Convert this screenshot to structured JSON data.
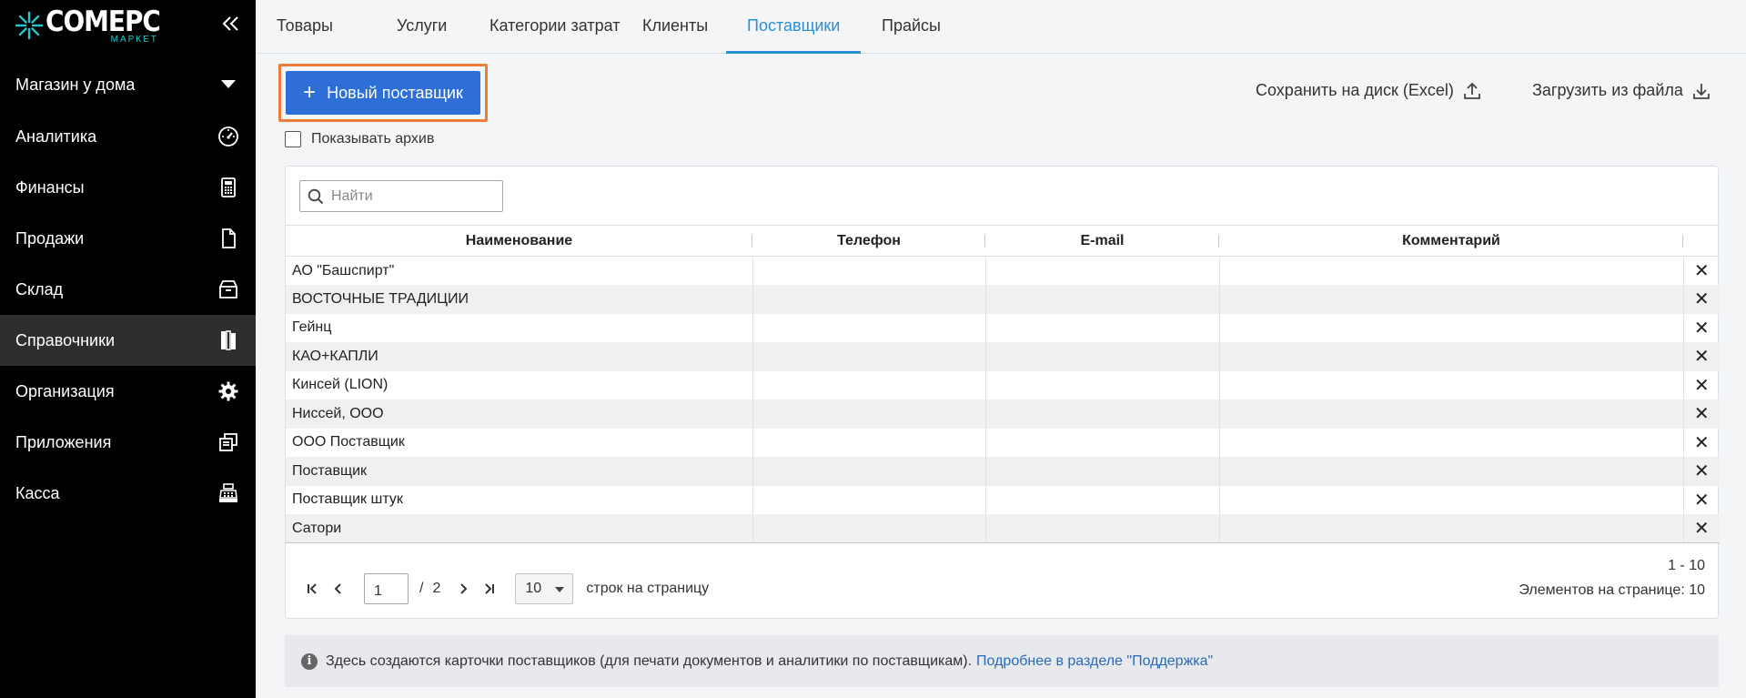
{
  "brand": {
    "name": "COMEPC",
    "sub": "МАРКЕТ"
  },
  "shop": {
    "name": "Магазин у дома"
  },
  "sidebar": {
    "items": [
      {
        "label": "Аналитика",
        "icon": "gauge-icon"
      },
      {
        "label": "Финансы",
        "icon": "calculator-icon"
      },
      {
        "label": "Продажи",
        "icon": "document-icon"
      },
      {
        "label": "Склад",
        "icon": "box-icon"
      },
      {
        "label": "Справочники",
        "icon": "books-icon",
        "active": true
      },
      {
        "label": "Организация",
        "icon": "gear-icon"
      },
      {
        "label": "Приложения",
        "icon": "windows-icon"
      },
      {
        "label": "Касса",
        "icon": "cash-register-icon"
      }
    ]
  },
  "tabs": [
    {
      "label": "Товары"
    },
    {
      "label": "Услуги"
    },
    {
      "label": "Категории затрат"
    },
    {
      "label": "Клиенты"
    },
    {
      "label": "Поставщики",
      "active": true
    },
    {
      "label": "Прайсы"
    }
  ],
  "toolbar": {
    "new_label": "Новый поставщик",
    "save_label": "Сохранить на диск (Excel)",
    "load_label": "Загрузить из файла",
    "archive_label": "Показывать архив"
  },
  "search": {
    "placeholder": "Найти",
    "value": ""
  },
  "table": {
    "columns": [
      "Наименование",
      "Телефон",
      "E-mail",
      "Комментарий"
    ],
    "rows": [
      {
        "name": "АО \"Башспирт\"",
        "phone": "",
        "email": "",
        "comment": ""
      },
      {
        "name": "ВОСТОЧНЫЕ ТРАДИЦИИ",
        "phone": "",
        "email": "",
        "comment": ""
      },
      {
        "name": "Гейнц",
        "phone": "",
        "email": "",
        "comment": ""
      },
      {
        "name": "КАО+КАПЛИ",
        "phone": "",
        "email": "",
        "comment": ""
      },
      {
        "name": "Кинсей (LION)",
        "phone": "",
        "email": "",
        "comment": ""
      },
      {
        "name": "Ниссей, ООО",
        "phone": "",
        "email": "",
        "comment": ""
      },
      {
        "name": "ООО Поставщик",
        "phone": "",
        "email": "",
        "comment": ""
      },
      {
        "name": "Поставщик",
        "phone": "",
        "email": "",
        "comment": ""
      },
      {
        "name": "Поставщик штук",
        "phone": "",
        "email": "",
        "comment": ""
      },
      {
        "name": "Сатори",
        "phone": "",
        "email": "",
        "comment": ""
      }
    ],
    "delete_glyph": "✕"
  },
  "pager": {
    "page": "1",
    "separator": "/",
    "total_pages": "2",
    "page_size": "10",
    "rows_label": "строк на страницу",
    "range": "1 - 10",
    "per_page_text": "Элементов на странице: 10"
  },
  "info": {
    "text": "Здесь создаются карточки поставщиков (для печати документов и аналитики по поставщикам).",
    "link": "Подробнее в разделе \"Поддержка\""
  },
  "colors": {
    "accent": "#2b8fd6",
    "primary_button": "#2d6fd6",
    "highlight": "#f07c3a",
    "sidebar_bg": "#000000"
  }
}
